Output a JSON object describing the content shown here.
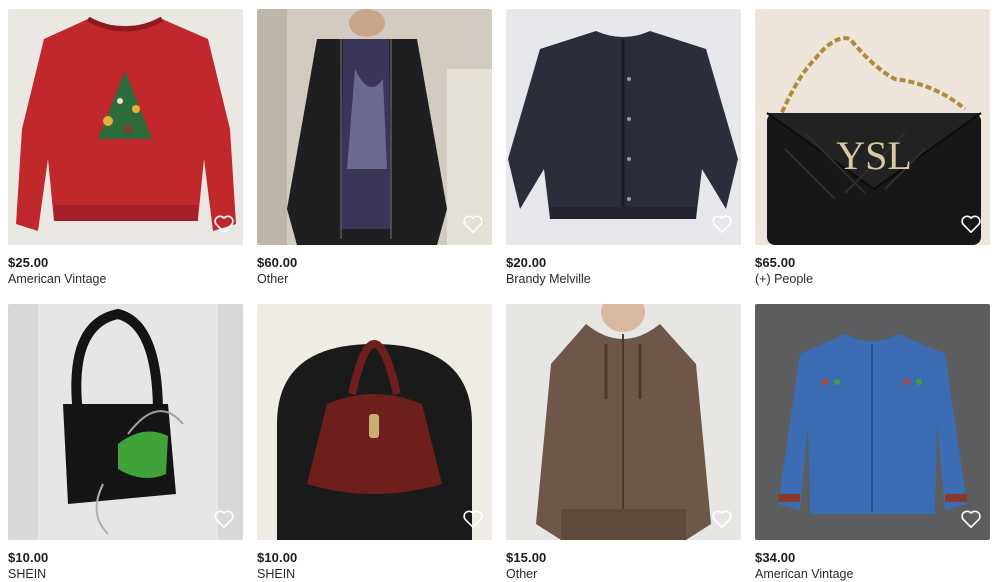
{
  "listings": [
    {
      "price": "$25.00",
      "brand": "American Vintage",
      "image_icon": "red-christmas-sweatshirt",
      "colors": {
        "bg": "#e9e6e1",
        "item": "#c0282c"
      }
    },
    {
      "price": "$60.00",
      "brand": "Other",
      "image_icon": "black-leather-jacket",
      "colors": {
        "bg": "#cfc8bd",
        "item": "#1f1f22"
      }
    },
    {
      "price": "$20.00",
      "brand": "Brandy Melville",
      "image_icon": "navy-bomber-jacket",
      "colors": {
        "bg": "#e6e7ea",
        "item": "#2a2c3a"
      }
    },
    {
      "price": "$65.00",
      "brand": "(+) People",
      "image_icon": "black-quilted-chain-bag",
      "colors": {
        "bg": "#ece4d8",
        "item": "#161616"
      }
    },
    {
      "price": "$10.00",
      "brand": "SHEIN",
      "image_icon": "black-and-green-bags",
      "colors": {
        "bg": "#dcdcdc",
        "item": "#141414"
      }
    },
    {
      "price": "$10.00",
      "brand": "SHEIN",
      "image_icon": "burgundy-leather-hobo-bag",
      "colors": {
        "bg": "#f0ece6",
        "item": "#6e1f1c"
      }
    },
    {
      "price": "$15.00",
      "brand": "Other",
      "image_icon": "brown-velour-zip-hoodie",
      "colors": {
        "bg": "#e7e5e2",
        "item": "#6e5748"
      }
    },
    {
      "price": "$34.00",
      "brand": "American Vintage",
      "image_icon": "denim-embroidered-jacket",
      "colors": {
        "bg": "#5d5e5f",
        "item": "#3c6cb4"
      }
    }
  ],
  "heart_icon": "heart-outline-icon"
}
